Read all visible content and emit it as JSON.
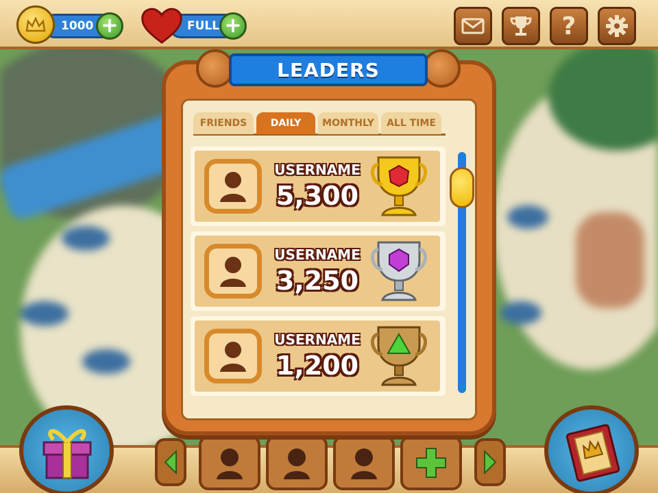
{
  "hud": {
    "coins": "1000",
    "lives": "FULL",
    "icons": [
      "crown-coin-icon",
      "heart-icon",
      "plus-icon",
      "mail-icon",
      "trophy-icon",
      "help-icon",
      "gear-icon"
    ]
  },
  "dialog": {
    "title": "LEADERS",
    "tabs": [
      {
        "label": "FRIENDS",
        "active": false
      },
      {
        "label": "DAILY",
        "active": true
      },
      {
        "label": "MONTHLY",
        "active": false
      },
      {
        "label": "ALL TIME",
        "active": false
      }
    ],
    "entries": [
      {
        "username": "USERNAME",
        "score": "5,300",
        "trophy": "gold-trophy-red-gem-icon"
      },
      {
        "username": "USERNAME",
        "score": "3,250",
        "trophy": "silver-trophy-purple-gem-icon"
      },
      {
        "username": "USERNAME",
        "score": "1,200",
        "trophy": "bronze-trophy-green-gem-icon"
      }
    ]
  },
  "bottom": {
    "left_button": "gift-icon",
    "right_button": "book-icon",
    "slots": [
      "avatar-icon",
      "avatar-icon",
      "avatar-icon",
      "plus-icon"
    ]
  },
  "colors": {
    "accent_blue": "#1f7fe0",
    "frame_orange": "#d9792f",
    "tab_active": "#d8731f",
    "plus_green": "#3d9a2a"
  }
}
